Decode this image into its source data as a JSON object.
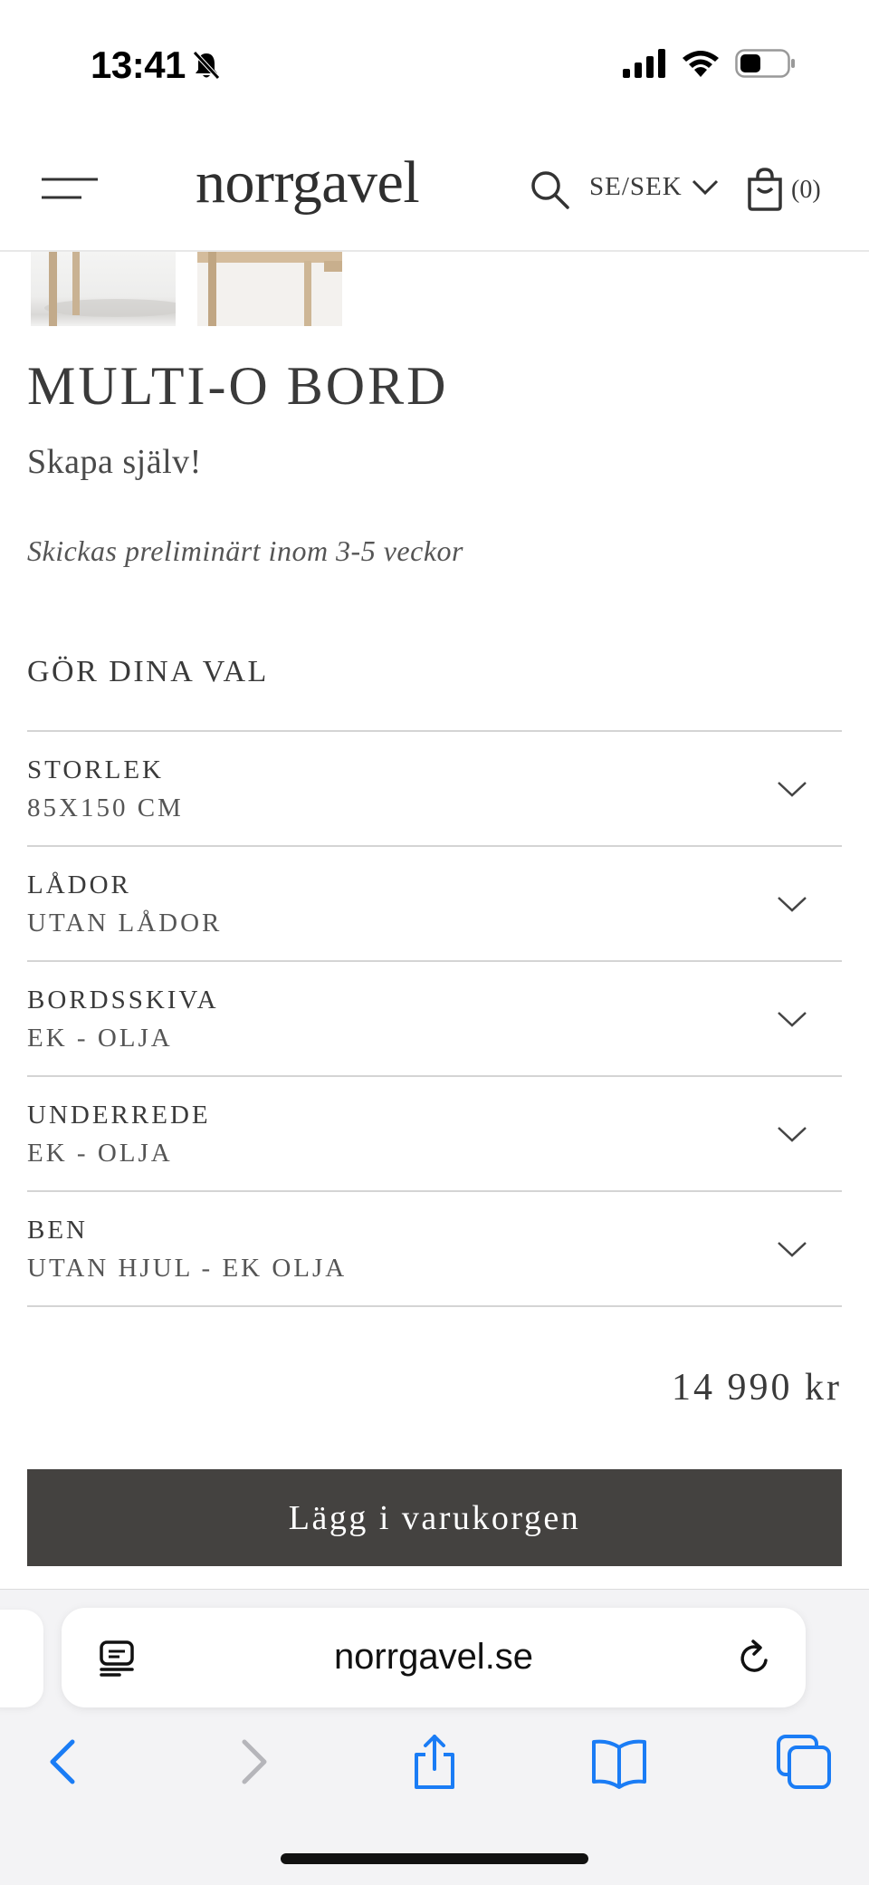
{
  "status_bar": {
    "time": "13:41"
  },
  "header": {
    "logo": "norrgavel",
    "currency": "SE/SEK",
    "cart_count": "(0)"
  },
  "product": {
    "title": "MULTI-O BORD",
    "subtitle": "Skapa själv!",
    "shipping_note": "Skickas preliminärt inom 3-5 veckor",
    "options_heading": "GÖR DINA VAL",
    "options": [
      {
        "name": "STORLEK",
        "value": "85X150 CM"
      },
      {
        "name": "LÅDOR",
        "value": "UTAN LÅDOR"
      },
      {
        "name": "BORDSSKIVA",
        "value": "EK - OLJA"
      },
      {
        "name": "UNDERREDE",
        "value": "EK - OLJA"
      },
      {
        "name": "BEN",
        "value": "UTAN HJUL - EK OLJA"
      }
    ],
    "price": "14 990 kr",
    "add_to_cart_label": "Lägg i varukorgen"
  },
  "browser": {
    "url": "norrgavel.se"
  },
  "colors": {
    "button_bg": "#444240",
    "text": "#3b3b3b",
    "ios_blue": "#1a7cf5"
  },
  "icons": {
    "status": [
      "bell-off-icon",
      "signal-icon",
      "wifi-icon",
      "battery-icon"
    ],
    "header": [
      "menu-icon",
      "search-icon",
      "chevron-down-icon",
      "cart-icon"
    ],
    "browser": [
      "reader-icon",
      "reload-icon",
      "back-icon",
      "forward-icon",
      "share-icon",
      "bookmarks-icon",
      "tabs-icon"
    ]
  }
}
